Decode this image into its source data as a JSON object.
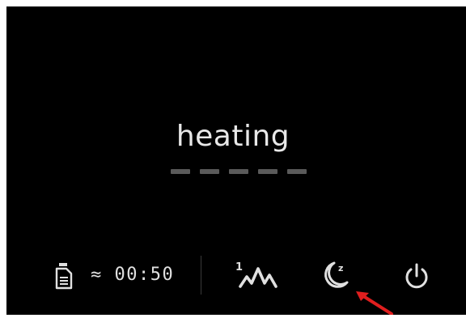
{
  "display": {
    "status": "heating",
    "progress_segments": 5,
    "timer": "≈ 00:50"
  },
  "controls": {
    "program_icon": "one-wave-icon",
    "sleep_icon": "moon-zzz-icon",
    "power_icon": "power-icon",
    "tank_icon": "water-tank-icon"
  },
  "colors": {
    "background": "#000000",
    "text": "#e8e8e8",
    "dash": "#5a5a5a",
    "annotation": "#e01e1e"
  }
}
